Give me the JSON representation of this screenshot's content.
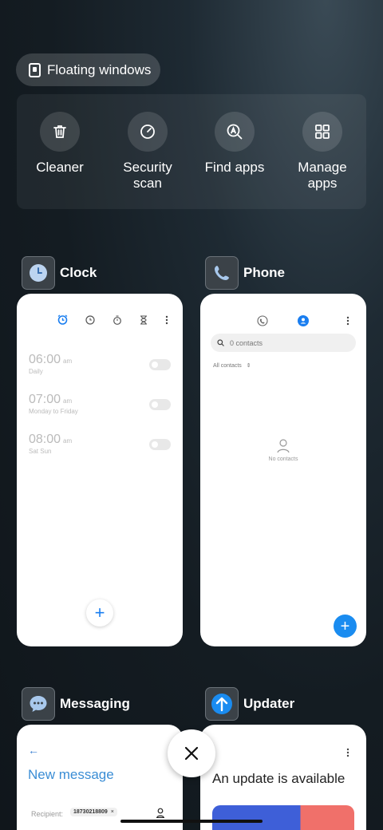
{
  "floating_windows": {
    "label": "Floating windows"
  },
  "tools": [
    {
      "label": "Cleaner",
      "icon": "trash-icon"
    },
    {
      "label": "Security scan",
      "icon": "security-scan-icon"
    },
    {
      "label": "Find apps",
      "icon": "find-apps-icon"
    },
    {
      "label": "Manage apps",
      "icon": "grid-icon"
    }
  ],
  "apps": {
    "clock": {
      "name": "Clock",
      "alarms": [
        {
          "time": "06:00",
          "ampm": "am",
          "repeat": "Daily",
          "enabled": false
        },
        {
          "time": "07:00",
          "ampm": "am",
          "repeat": "Monday to Friday",
          "enabled": false
        },
        {
          "time": "08:00",
          "ampm": "am",
          "repeat": "Sat Sun",
          "enabled": false
        }
      ],
      "add_label": "+"
    },
    "phone": {
      "name": "Phone",
      "search_placeholder": "0 contacts",
      "filter_label": "All contacts",
      "empty_label": "No contacts",
      "add_label": "+"
    },
    "messaging": {
      "name": "Messaging",
      "title": "New message",
      "recipient_label": "Recipient:",
      "recipient_value": "18730218809",
      "back_label": "←"
    },
    "updater": {
      "name": "Updater",
      "title": "An update is available"
    }
  },
  "colors": {
    "accent": "#1a8cf0",
    "background": "#141c22"
  }
}
